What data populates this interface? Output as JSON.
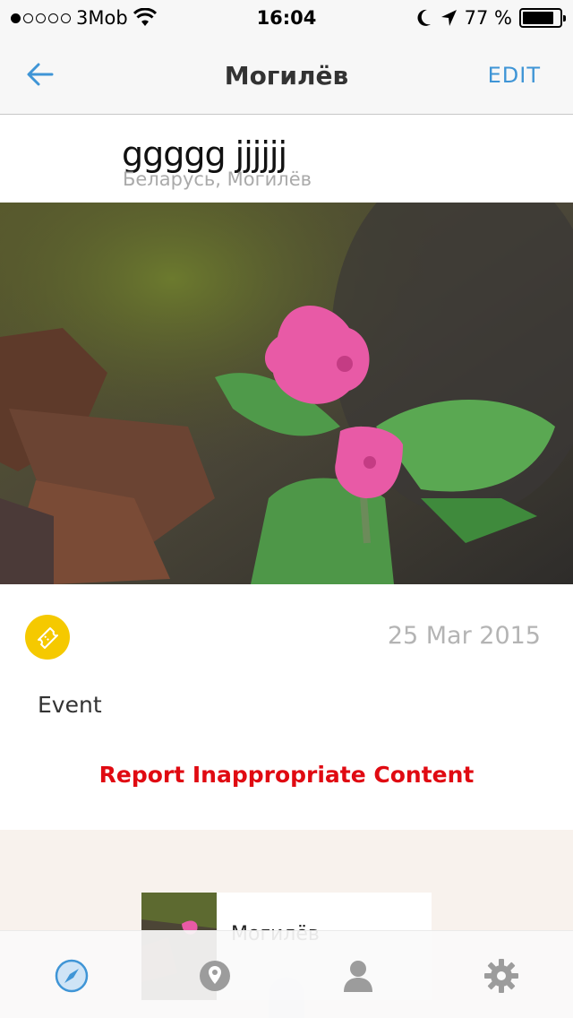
{
  "status_bar": {
    "signal_dots_filled": 1,
    "signal_dots_total": 5,
    "carrier": "3Mob",
    "time": "16:04",
    "battery_percent": "77 %"
  },
  "nav": {
    "title": "Могилёв",
    "edit_label": "EDIT"
  },
  "post": {
    "title": "ggggg jjjjjj",
    "location": "Беларусь, Могилёв",
    "date": "25 Mar 2015",
    "category": "Event",
    "report_label": "Report Inappropriate Content"
  },
  "related": {
    "card_title": "Могилёв"
  },
  "colors": {
    "accent": "#3f95d6",
    "event_badge": "#f5c900",
    "report": "#e00a12",
    "related_bg": "#f8f2ed"
  },
  "tabs": [
    {
      "name": "explore",
      "icon": "compass-icon",
      "active": true
    },
    {
      "name": "map",
      "icon": "map-pin-icon",
      "active": false
    },
    {
      "name": "profile",
      "icon": "person-icon",
      "active": false
    },
    {
      "name": "settings",
      "icon": "gear-icon",
      "active": false
    }
  ]
}
